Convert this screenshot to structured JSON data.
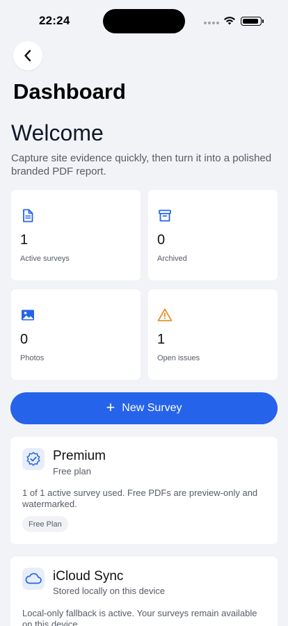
{
  "status_bar": {
    "time": "22:24"
  },
  "header": {
    "title": "Dashboard"
  },
  "welcome": {
    "heading": "Welcome",
    "subtitle": "Capture site evidence quickly, then turn it into a polished branded PDF report."
  },
  "stats": [
    {
      "icon": "document-icon",
      "value": "1",
      "label": "Active surveys"
    },
    {
      "icon": "archive-icon",
      "value": "0",
      "label": "Archived"
    },
    {
      "icon": "photo-icon",
      "value": "0",
      "label": "Photos"
    },
    {
      "icon": "warning-icon",
      "value": "1",
      "label": "Open issues"
    }
  ],
  "actions": {
    "new_survey": "New Survey"
  },
  "premium": {
    "title": "Premium",
    "subtitle": "Free plan",
    "body": "1 of 1 active survey used. Free PDFs are preview-only and watermarked.",
    "chip": "Free Plan"
  },
  "icloud": {
    "title": "iCloud Sync",
    "subtitle": "Stored locally on this device",
    "body": "Local-only fallback is active. Your surveys remain available on this device."
  },
  "colors": {
    "accent": "#2563EB",
    "warning": "#E8922E",
    "background": "#F2F3F7"
  }
}
